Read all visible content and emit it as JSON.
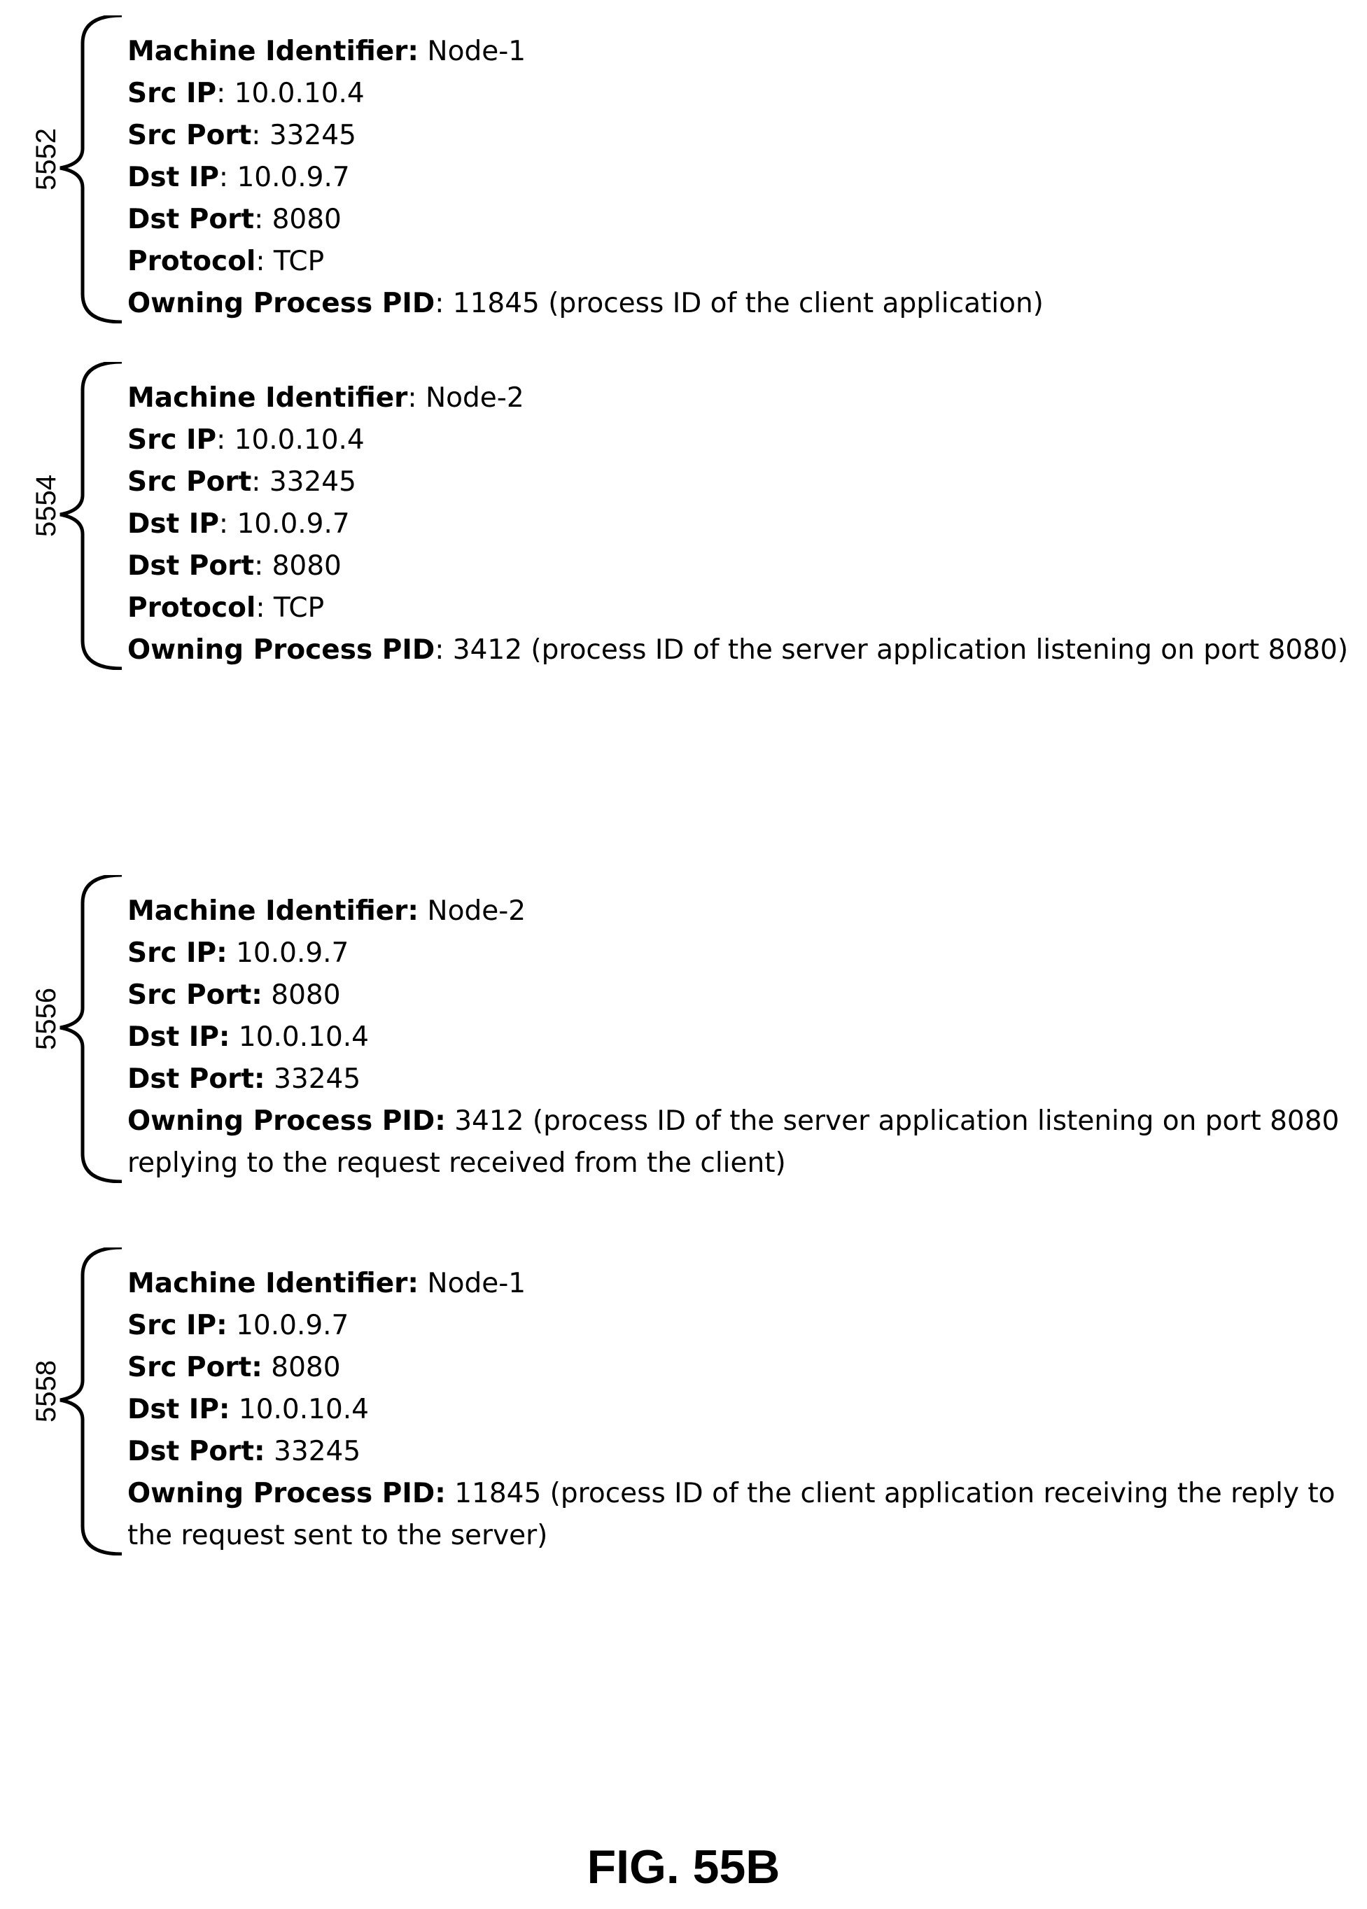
{
  "blocks": [
    {
      "ref": "5552",
      "fields": [
        {
          "key": "Machine Identifier:",
          "value": " Node-1"
        },
        {
          "key": "Src IP",
          "value": ": 10.0.10.4"
        },
        {
          "key": "Src Port",
          "value": ": 33245"
        },
        {
          "key": "Dst IP",
          "value": ": 10.0.9.7"
        },
        {
          "key": "Dst Port",
          "value": ": 8080"
        },
        {
          "key": "Protocol",
          "value": ": TCP"
        },
        {
          "key": "Owning Process PID",
          "value": ": 11845 (process ID of the client application)"
        }
      ]
    },
    {
      "ref": "5554",
      "fields": [
        {
          "key": "Machine Identifier",
          "value": ": Node-2"
        },
        {
          "key": "Src IP",
          "value": ": 10.0.10.4"
        },
        {
          "key": "Src Port",
          "value": ": 33245"
        },
        {
          "key": "Dst IP",
          "value": ": 10.0.9.7"
        },
        {
          "key": "Dst Port",
          "value": ": 8080"
        },
        {
          "key": "Protocol",
          "value": ": TCP"
        },
        {
          "key": "Owning Process PID",
          "value": ": 3412 (process ID of the server application listening on port 8080)"
        }
      ]
    },
    {
      "ref": "5556",
      "fields": [
        {
          "key": "Machine Identifier:",
          "value": " Node-2"
        },
        {
          "key": "Src IP:",
          "value": " 10.0.9.7"
        },
        {
          "key": "Src Port:",
          "value": " 8080"
        },
        {
          "key": "Dst IP:",
          "value": " 10.0.10.4"
        },
        {
          "key": "Dst Port:",
          "value": " 33245"
        },
        {
          "key": "Owning Process PID:",
          "value": " 3412 (process ID of the server application listening on port 8080"
        },
        {
          "key": "",
          "value": "replying to the request received from the client)"
        }
      ]
    },
    {
      "ref": "5558",
      "fields": [
        {
          "key": "Machine Identifier:",
          "value": " Node-1"
        },
        {
          "key": "Src IP:",
          "value": " 10.0.9.7"
        },
        {
          "key": "Src Port:",
          "value": " 8080"
        },
        {
          "key": "Dst IP:",
          "value": " 10.0.10.4"
        },
        {
          "key": "Dst Port:",
          "value": " 33245"
        },
        {
          "key": "Owning Process PID:",
          "value": " 11845 (process ID of the client application receiving the reply to"
        },
        {
          "key": "",
          "value": "the request sent to the server)"
        }
      ]
    }
  ],
  "figure_title": "FIG. 55B"
}
